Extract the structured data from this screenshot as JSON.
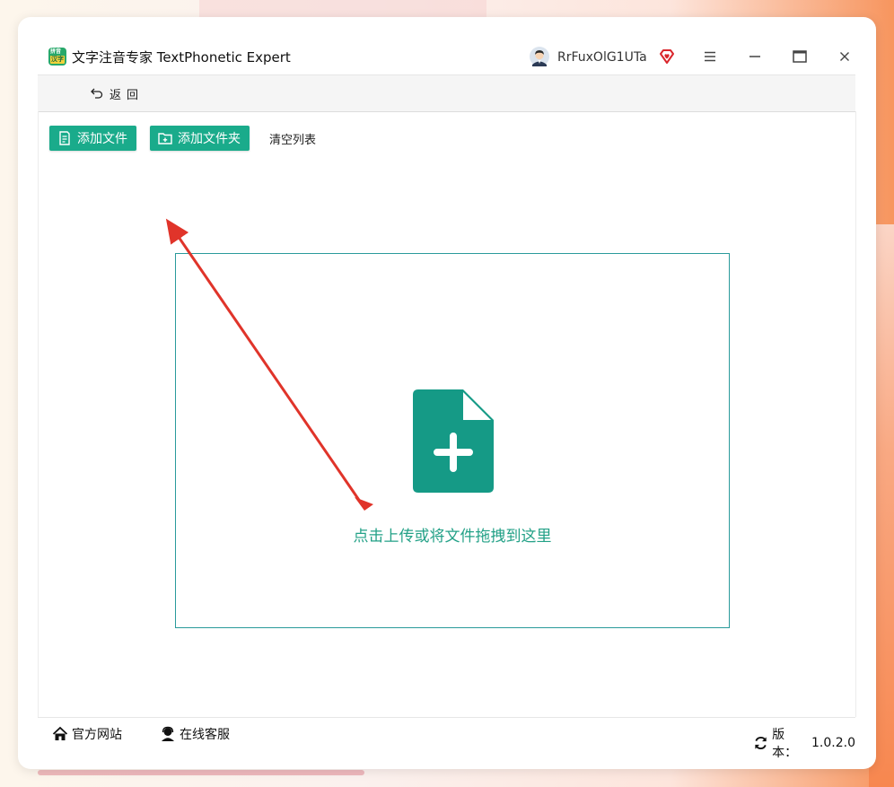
{
  "app": {
    "logo_top": "拼音",
    "logo_bottom": "汉字",
    "title": "文字注音专家 TextPhonetic Expert"
  },
  "user": {
    "name": "RrFuxOlG1UTa"
  },
  "nav": {
    "back_label": "返回"
  },
  "toolbar": {
    "add_file": "添加文件",
    "add_folder": "添加文件夹",
    "clear_list": "清空列表"
  },
  "dropzone": {
    "text": "点击上传或将文件拖拽到这里"
  },
  "footer": {
    "website": "官方网站",
    "service": "在线客服",
    "version_label": "版本：",
    "version": "1.0.2.0"
  },
  "icons": {
    "back": "undo-arrow-icon",
    "add_file": "file-list-icon",
    "add_folder": "folder-plus-icon",
    "drop": "file-plus-icon",
    "home": "home-icon",
    "service": "headset-icon",
    "version": "refresh-icon",
    "vip": "diamond-heart-icon"
  },
  "colors": {
    "accent": "#1aab8b",
    "dropzone_border": "#2a9a9b",
    "icon_fill": "#159a86",
    "drop_text": "#23a187",
    "annotation_arrow": "#e0342a",
    "vip": "#d9262c"
  }
}
